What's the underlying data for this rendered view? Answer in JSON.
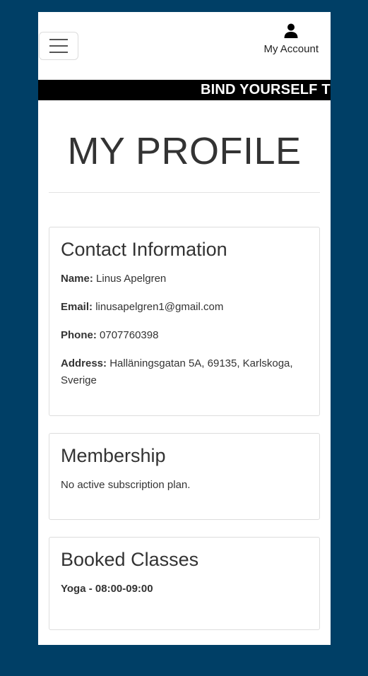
{
  "header": {
    "menu_icon": "hamburger-menu-icon",
    "account_icon": "user-icon",
    "account_label": "My Account"
  },
  "ticker": {
    "text": "BIND YOURSELF TO"
  },
  "page": {
    "title": "MY PROFILE"
  },
  "contact": {
    "heading": "Contact Information",
    "name_label": "Name:",
    "name_value": "Linus Apelgren",
    "email_label": "Email:",
    "email_value": "linusapelgren1@gmail.com",
    "phone_label": "Phone:",
    "phone_value": "0707760398",
    "address_label": "Address:",
    "address_value": "Halläningsgatan 5A, 69135, Karlskoga, Sverige"
  },
  "membership": {
    "heading": "Membership",
    "status": "No active subscription plan."
  },
  "classes": {
    "heading": "Booked Classes",
    "items": [
      "Yoga - 08:00-09:00"
    ]
  },
  "colors": {
    "background": "#003f66",
    "ticker_bg": "#000000",
    "ticker_text": "#ffffff",
    "text": "#333333"
  }
}
